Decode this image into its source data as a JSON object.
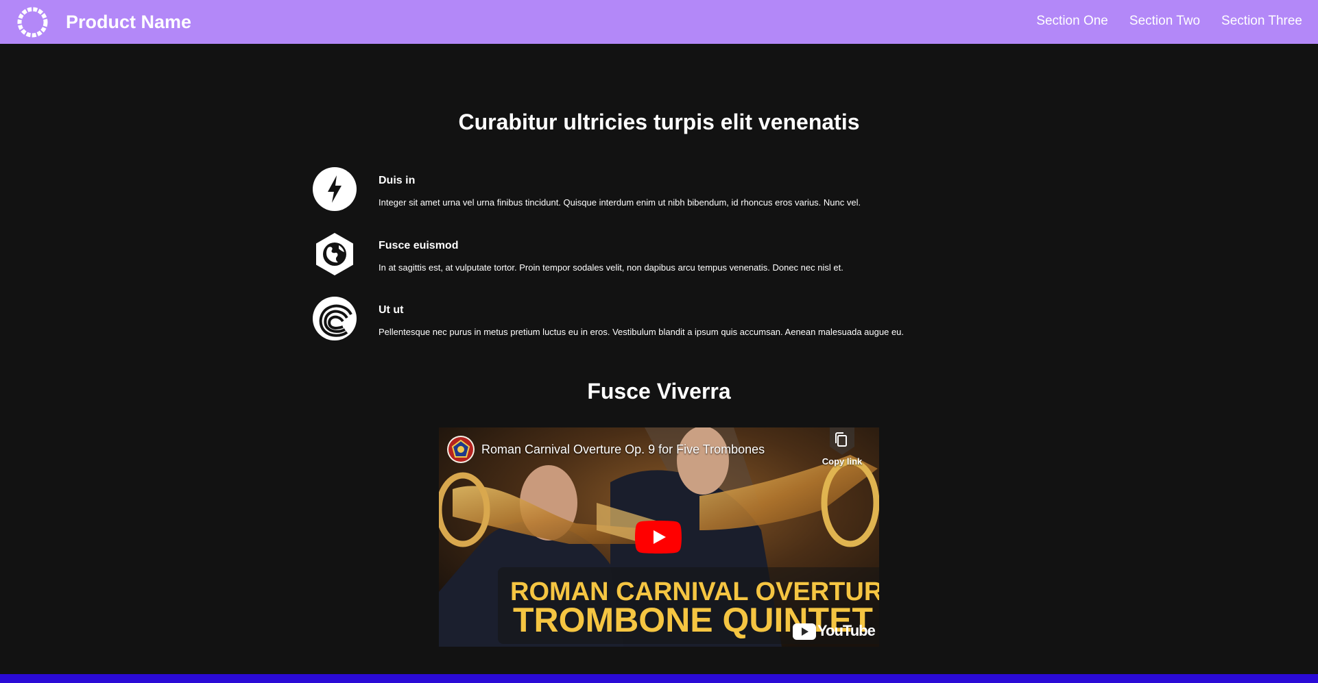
{
  "nav": {
    "brand": "Product Name",
    "links": [
      "Section One",
      "Section Two",
      "Section Three"
    ],
    "background": "#b388f8"
  },
  "hero": {
    "title": "Curabitur ultricies turpis elit venenatis"
  },
  "features": [
    {
      "icon": "lightning-bolt-icon",
      "title": "Duis in",
      "text": "Integer sit amet urna vel urna finibus tincidunt. Quisque interdum enim ut nibh bibendum, id rhoncus eros varius. Nunc vel."
    },
    {
      "icon": "globe-hexagon-icon",
      "title": "Fusce euismod",
      "text": "In at sagittis est, at vulputate tortor. Proin tempor sodales velit, non dapibus arcu tempus venenatis. Donec nec nisl et."
    },
    {
      "icon": "swirl-waves-icon",
      "title": "Ut ut",
      "text": "Pellentesque nec purus in metus pretium luctus eu in eros. Vestibulum blandit a ipsum quis accumsan. Aenean malesuada augue eu."
    }
  ],
  "video_section": {
    "title": "Fusce Viverra",
    "video": {
      "title": "Roman Carnival Overture Op. 9 for Five Trombones",
      "copy_link_label": "Copy link",
      "banner_line1": "ROMAN CARNIVAL OVERTURE",
      "banner_line2": "TROMBONE QUINTET",
      "brand_word": "YouTube"
    }
  },
  "colors": {
    "page_background": "#121212",
    "footer_bar": "#2a0ad6",
    "play_button": "#ff0000",
    "banner_text": "#f5c542"
  }
}
